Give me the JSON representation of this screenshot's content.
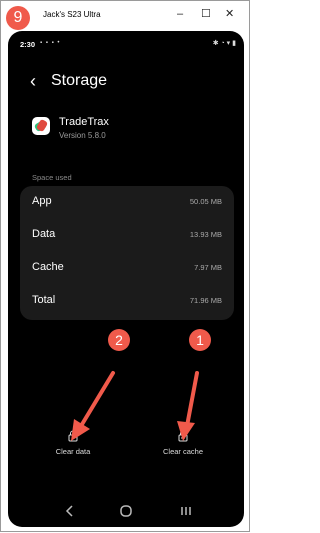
{
  "window": {
    "title": "Jack's S23 Ultra",
    "controls": [
      "–",
      "☐",
      "✕"
    ],
    "step_badge": "9"
  },
  "status_bar": {
    "time": "2:30",
    "left_icons": "▪ ▪ ▪ •",
    "right_icons": "✱ ◔ ▾ ▮"
  },
  "header": {
    "back_icon": "chevron-left-icon",
    "title": "Storage"
  },
  "app": {
    "name": "TradeTrax",
    "version": "Version 5.8.0"
  },
  "storage": {
    "section_title": "Space used",
    "rows": [
      {
        "label": "App",
        "value": "50.05 MB"
      },
      {
        "label": "Data",
        "value": "13.93 MB"
      },
      {
        "label": "Cache",
        "value": "7.97 MB"
      },
      {
        "label": "Total",
        "value": "71.96 MB"
      }
    ]
  },
  "actions": {
    "clear_data": "Clear data",
    "clear_cache": "Clear cache"
  },
  "annotations": {
    "badge_1": "1",
    "badge_2": "2",
    "accent": "#f05a4b"
  },
  "colors": {
    "background": "#000000",
    "card": "#1b1b1b",
    "accent": "#f05a4b"
  }
}
